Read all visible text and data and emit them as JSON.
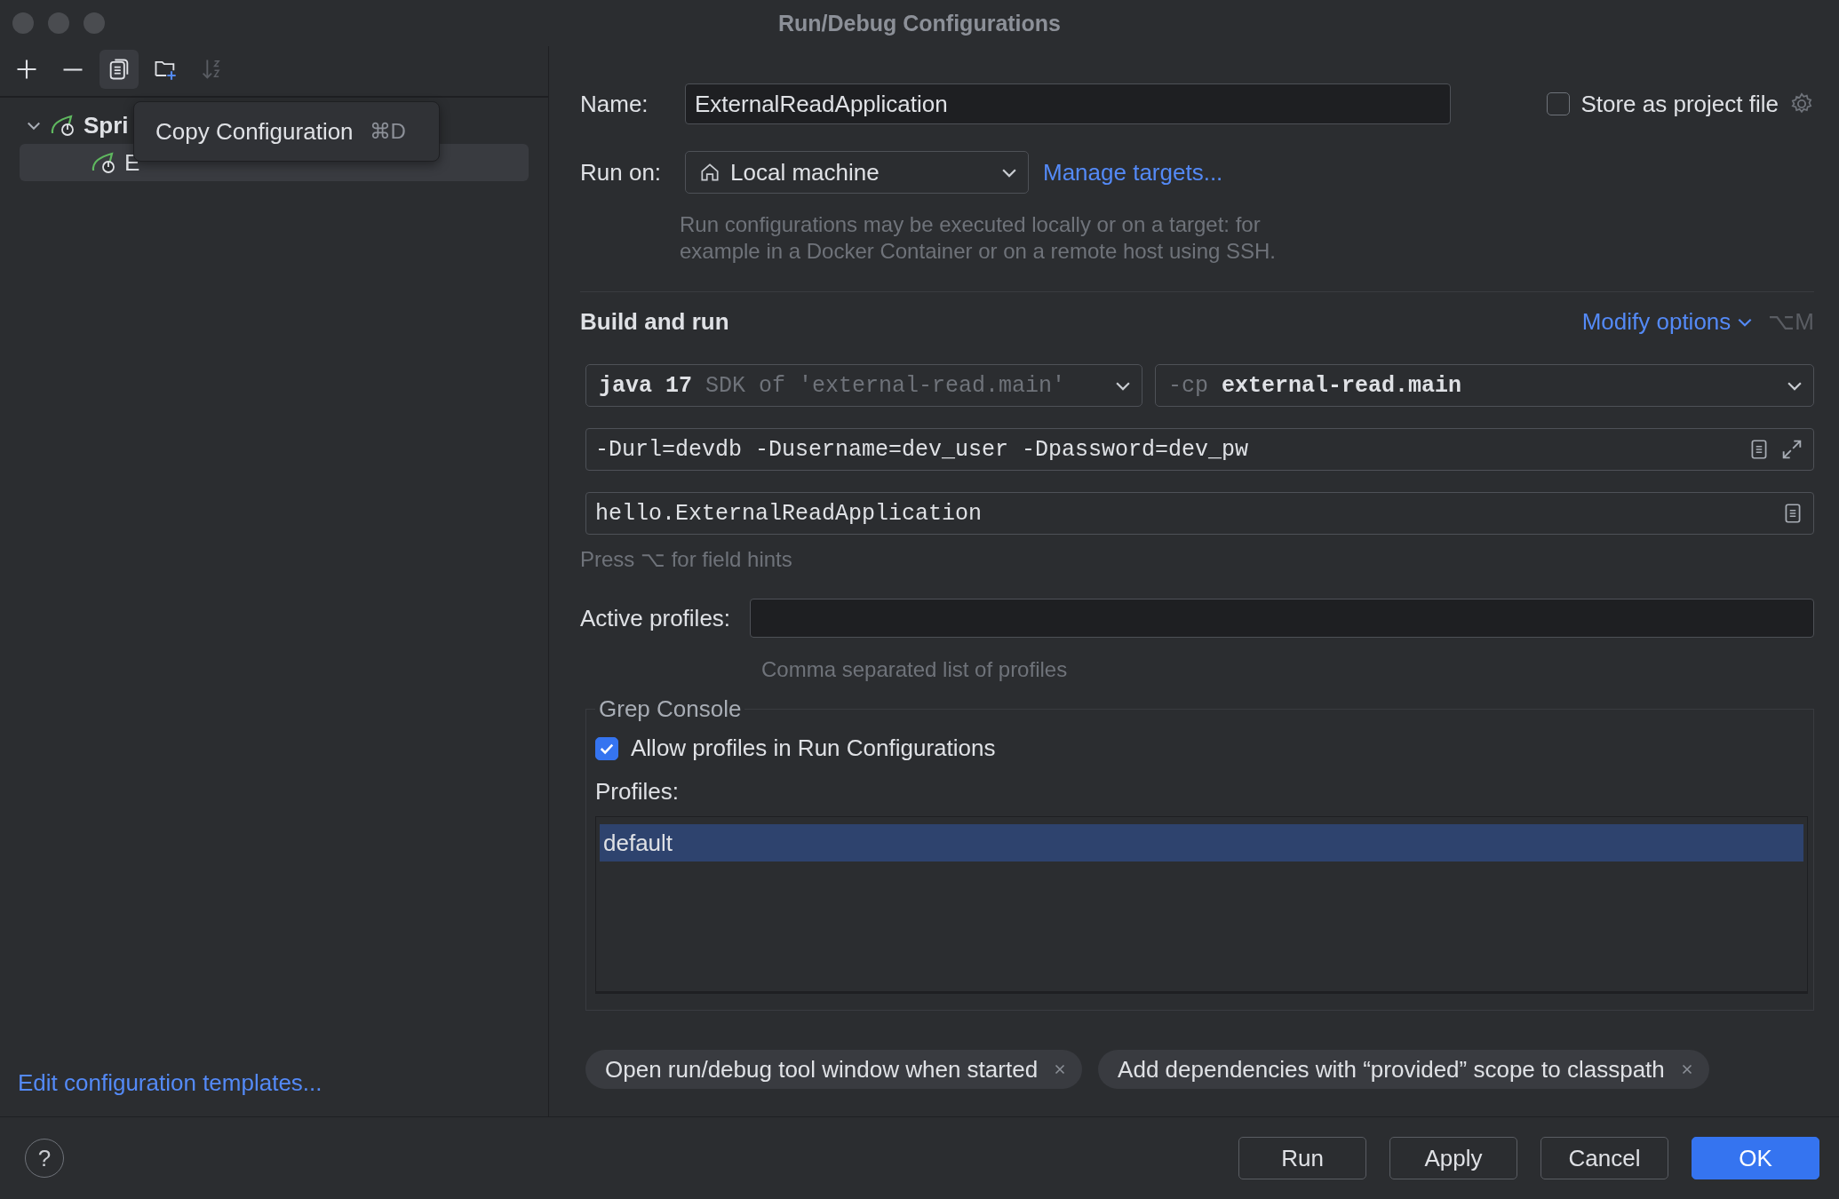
{
  "window": {
    "title": "Run/Debug Configurations"
  },
  "toolbar": [
    {
      "kind": "add",
      "selected": false,
      "disabled": false
    },
    {
      "kind": "remove",
      "selected": false,
      "disabled": false
    },
    {
      "kind": "copy",
      "selected": true,
      "disabled": false
    },
    {
      "kind": "folder",
      "selected": false,
      "disabled": false
    },
    {
      "kind": "sort",
      "selected": false,
      "disabled": true
    }
  ],
  "tree": [
    {
      "kind": "group",
      "label": "Spri",
      "expanded": true,
      "selected": false,
      "children": [
        {
          "label": "E",
          "selected": true
        }
      ]
    }
  ],
  "tooltip": {
    "label": "Copy Configuration",
    "shortcut": "⌘D"
  },
  "templates_link": "Edit configuration templates...",
  "name": {
    "label": "Name:",
    "value": "ExternalReadApplication"
  },
  "store_as_project_file": {
    "label": "Store as project file",
    "checked": false
  },
  "run_on": {
    "label": "Run on:",
    "value": "Local machine",
    "link": "Manage targets...",
    "hint": "Run configurations may be executed locally or on a target: for example in a Docker Container or on a remote host using SSH."
  },
  "build_and_run": {
    "title": "Build and run",
    "modify": "Modify options",
    "modify_shortcut": "⌥M",
    "sdk": {
      "name": "java 17",
      "detail": "SDK of 'external-read.main'"
    },
    "classpath": {
      "flag": "-cp",
      "value": "external-read.main"
    },
    "vm_options": "-Durl=devdb -Dusername=dev_user -Dpassword=dev_pw",
    "main_class": "hello.ExternalReadApplication",
    "field_hint": "Press ⌥ for field hints"
  },
  "active_profiles": {
    "label": "Active profiles:",
    "hint": "Comma separated list of profiles"
  },
  "grep_console": {
    "title": "Grep Console",
    "allow": {
      "label": "Allow profiles in Run Configurations",
      "checked": true
    },
    "profiles_label": "Profiles:",
    "profiles": [
      {
        "label": "default",
        "selected": true
      }
    ]
  },
  "chips": [
    "Open run/debug tool window when started",
    "Add dependencies with “provided” scope to classpath"
  ],
  "help": "?",
  "buttons": [
    {
      "label": "Run",
      "kind": "default"
    },
    {
      "label": "Apply",
      "kind": "default"
    },
    {
      "label": "Cancel",
      "kind": "default"
    },
    {
      "label": "OK",
      "kind": "primary"
    }
  ]
}
